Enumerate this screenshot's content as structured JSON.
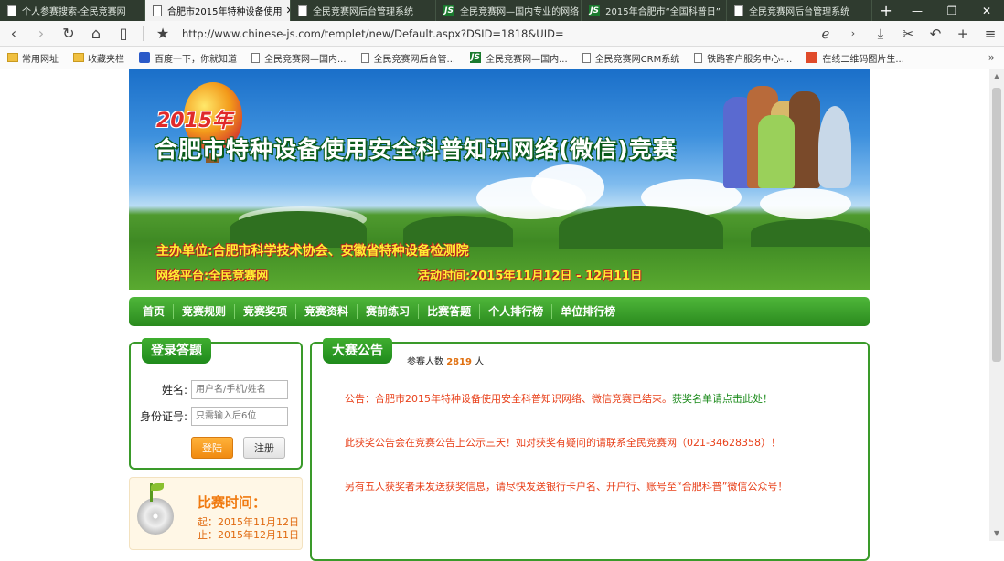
{
  "tabs": [
    {
      "label": "个人参赛搜索-全民竞赛网",
      "icon": "page-icon",
      "active": false
    },
    {
      "label": "合肥市2015年特种设备使用",
      "icon": "page-icon",
      "active": true
    },
    {
      "label": "全民竞赛网后台管理系统",
      "icon": "page-icon",
      "active": false
    },
    {
      "label": "全民竞赛网—国内专业的网络",
      "icon": "js-logo-icon",
      "active": false
    },
    {
      "label": "2015年合肥市“全国科普日”",
      "icon": "js-logo-icon",
      "active": false
    },
    {
      "label": "全民竞赛网后台管理系统",
      "icon": "page-icon",
      "active": false
    }
  ],
  "address": {
    "url": "http://www.chinese-js.com/templet/new/Default.aspx?DSID=1818&UID="
  },
  "bookmarks": [
    {
      "label": "常用网址",
      "icon": "folder"
    },
    {
      "label": "收藏夹栏",
      "icon": "folder"
    },
    {
      "label": "百度一下，你就知道",
      "icon": "baidu"
    },
    {
      "label": "全民竞赛网—国内...",
      "icon": "page"
    },
    {
      "label": "全民竞赛网后台管...",
      "icon": "page"
    },
    {
      "label": "全民竞赛网—国内...",
      "icon": "js"
    },
    {
      "label": "全民竞赛网CRM系统",
      "icon": "page"
    },
    {
      "label": "铁路客户服务中心-...",
      "icon": "page"
    },
    {
      "label": "在线二维码图片生...",
      "icon": "qr"
    }
  ],
  "banner": {
    "year": "2015年",
    "title": "合肥市特种设备使用安全科普知识网络(微信)竞赛",
    "host": "主办单位:合肥市科学技术协会、安徽省特种设备检测院",
    "platform": "网络平台:全民竞赛网",
    "time": "活动时间:2015年11月12日 - 12月11日"
  },
  "nav": [
    "首页",
    "竞赛规则",
    "竞赛奖项",
    "竞赛资料",
    "赛前练习",
    "比赛答题",
    "个人排行榜",
    "单位排行榜"
  ],
  "login": {
    "title": "登录答题",
    "name_label": "姓名:",
    "name_placeholder": "用户名/手机/姓名",
    "id_label": "身份证号:",
    "id_placeholder": "只需输入后6位",
    "login_btn": "登陆",
    "register_btn": "注册"
  },
  "contest_time": {
    "title": "比赛时间：",
    "start": "起：2015年11月12日",
    "end": "止：2015年12月11日"
  },
  "notice": {
    "title": "大赛公告",
    "count_prefix": "参赛人数",
    "count": "2819",
    "count_suffix": "人",
    "line1_red": "公告：合肥市2015年特种设备使用安全科普知识网络、微信竞赛已结束。",
    "line1_green": "获奖名单请点击此处！",
    "line2": "此获奖公告会在竞赛公告上公示三天！如对获奖有疑问的请联系全民竞赛网（021-34628358）！",
    "line3": "另有五人获奖者未发送获奖信息，请尽快发送银行卡户名、开户行、账号至“合肥科普”微信公众号！"
  }
}
